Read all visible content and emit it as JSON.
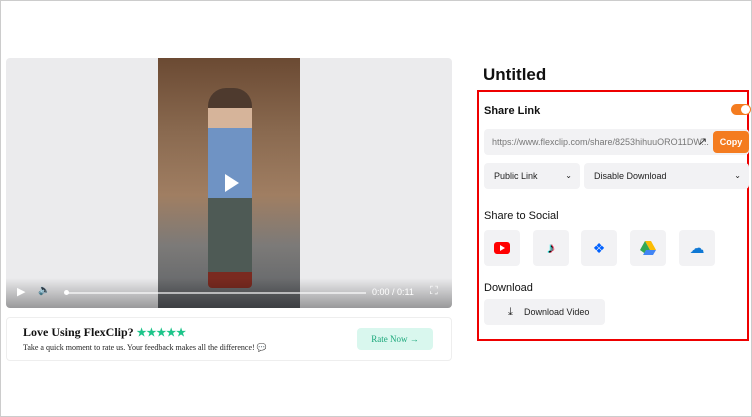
{
  "player": {
    "time": "0:00 / 0:11",
    "progress": 0
  },
  "rating": {
    "title": "Love Using FlexClip?",
    "stars": "★★★★★",
    "text": "Take a quick moment to rate us. Your feedback makes all the difference!",
    "button": "Rate Now"
  },
  "project": {
    "title": "Untitled"
  },
  "share": {
    "label": "Share Link",
    "enabled": true,
    "url": "https://www.flexclip.com/share/8253hihuuORO11DW...",
    "copy": "Copy",
    "link_type": "Public Link",
    "download_option": "Disable Download"
  },
  "social": {
    "label": "Share to Social",
    "items": [
      "youtube",
      "tiktok",
      "dropbox",
      "google-drive",
      "onedrive"
    ]
  },
  "download": {
    "label": "Download",
    "button": "Download Video"
  },
  "colors": {
    "accent": "#f47c20",
    "highlight": "#e00000",
    "rate": "#1dc58a"
  }
}
